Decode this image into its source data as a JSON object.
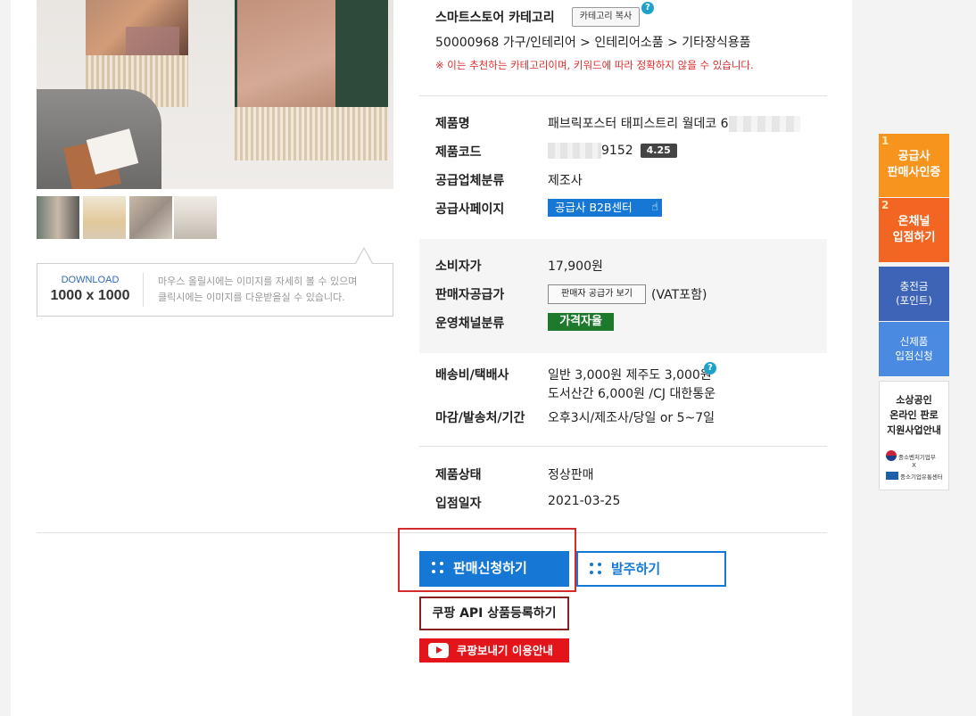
{
  "download": {
    "label": "DOWNLOAD",
    "size": "1000 x 1000",
    "desc_line1": "마우스 올릴시에는 이미지를 자세히 볼 수 있으며",
    "desc_line2": "클릭시에는 이미지를 다운받을실 수 있습니다."
  },
  "category": {
    "title": "스마트스토어 카테고리",
    "copy_button": "카테고리 복사",
    "help": "?",
    "path": "50000968 가구/인테리어 > 인테리어소품 > 기타장식용품",
    "warning": "※ 이는 추천하는 카테고리이며, 키워드에 따라 정확하지 않을 수 있습니다."
  },
  "product": {
    "name_label": "제품명",
    "name_value": "패브릭포스터 태피스트리 월데코 6",
    "code_label": "제품코드",
    "code_value": "9152",
    "code_badge": "4.25",
    "supplier_type_label": "공급업체분류",
    "supplier_type_value": "제조사",
    "supplier_page_label": "공급사페이지",
    "supplier_page_button": "공급사 B2B센터"
  },
  "pricing": {
    "consumer_label": "소비자가",
    "consumer_value": "17,900원",
    "seller_label": "판매자공급가",
    "seller_button": "판매자 공급가 보기",
    "seller_vat": "(VAT포함)",
    "channel_label": "운영채널분류",
    "channel_value": "가격자율"
  },
  "shipping": {
    "fee_label": "배송비/택배사",
    "fee_line1": "일반 3,000원 제주도 3,000원",
    "fee_line2": "도서산간 6,000원 /CJ 대한통운",
    "deadline_label": "마감/발송처/기간",
    "deadline_value": "오후3시/제조사/당일 or 5~7일"
  },
  "status": {
    "state_label": "제품상태",
    "state_value": "정상판매",
    "date_label": "입점일자",
    "date_value": "2021-03-25"
  },
  "actions": {
    "sell_apply": "판매신청하기",
    "order": "발주하기",
    "coupang_api": "쿠팡 API 상품등록하기",
    "coupang_guide": "쿠팡보내기 이용안내"
  },
  "side": {
    "item1_num": "1",
    "item1_line1": "공급사",
    "item1_line2": "판매사인증",
    "item2_num": "2",
    "item2_line1": "온채널",
    "item2_line2": "입점하기",
    "item3_line1": "충전금",
    "item3_line2": "(포인트)",
    "item4_line1": "신제품",
    "item4_line2": "입점신청",
    "support_line1": "소상공인",
    "support_line2": "온라인 판로",
    "support_line3": "지원사업안내",
    "gov_org": "중소벤처기업부",
    "x": "X",
    "agency": "중소기업유통센터"
  },
  "colors": {
    "blue": "#1678d4",
    "orange": "#f7941d",
    "orange_red": "#f26522",
    "side_blue": "#3e64b8",
    "side_light_blue": "#4a8ae0",
    "red": "#e4141b",
    "green": "#1d7a2c"
  }
}
